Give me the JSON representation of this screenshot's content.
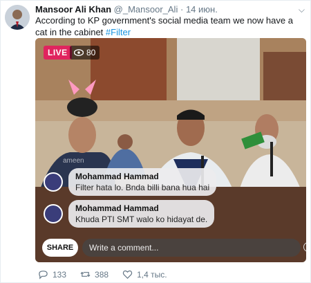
{
  "tweet": {
    "author_name": "Mansoor Ali Khan",
    "handle": "@_Mansoor_Ali",
    "separator": "·",
    "date": "14 июн.",
    "text": "According to KP government's social media team we now have a cat in the cabinet",
    "hashtag": "#Filter"
  },
  "video": {
    "live_label": "LIVE",
    "viewer_count": "80",
    "watermark": "ameen",
    "comments": [
      {
        "name": "Mohammad Hammad",
        "text": "Filter hata lo. Bnda billi bana hua hai"
      },
      {
        "name": "Mohammad Hammad",
        "text": "Khuda PTI SMT walo ko hidayat de."
      }
    ],
    "share_label": "SHARE",
    "comment_placeholder": "Write a comment..."
  },
  "actions": {
    "replies": "133",
    "retweets": "388",
    "likes": "1,4 тыс."
  },
  "colors": {
    "live": "#e0245e",
    "link": "#1b95e0",
    "muted": "#657786"
  }
}
